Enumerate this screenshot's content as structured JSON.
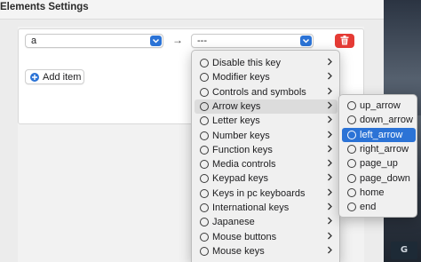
{
  "window": {
    "title": "Elements Settings"
  },
  "row": {
    "from_value": "a",
    "to_value": "---",
    "arrow_glyph": "→",
    "add_item_label": "Add item"
  },
  "category_menu": {
    "items": [
      {
        "label": "Disable this key",
        "has_submenu": true
      },
      {
        "label": "Modifier keys",
        "has_submenu": true
      },
      {
        "label": "Controls and symbols",
        "has_submenu": true
      },
      {
        "label": "Arrow keys",
        "has_submenu": true,
        "state": "hover"
      },
      {
        "label": "Letter keys",
        "has_submenu": true
      },
      {
        "label": "Number keys",
        "has_submenu": true
      },
      {
        "label": "Function keys",
        "has_submenu": true
      },
      {
        "label": "Media controls",
        "has_submenu": true
      },
      {
        "label": "Keypad keys",
        "has_submenu": true
      },
      {
        "label": "Keys in pc keyboards",
        "has_submenu": true
      },
      {
        "label": "International keys",
        "has_submenu": true
      },
      {
        "label": "Japanese",
        "has_submenu": true
      },
      {
        "label": "Mouse buttons",
        "has_submenu": true
      },
      {
        "label": "Mouse keys",
        "has_submenu": true
      }
    ]
  },
  "key_menu": {
    "items": [
      {
        "label": "up_arrow"
      },
      {
        "label": "down_arrow"
      },
      {
        "label": "left_arrow",
        "state": "selected"
      },
      {
        "label": "right_arrow"
      },
      {
        "label": "page_up"
      },
      {
        "label": "page_down"
      },
      {
        "label": "home"
      },
      {
        "label": "end"
      }
    ]
  },
  "icons": {
    "chevron": "chevron-up-down-icon",
    "delete": "trash-icon",
    "add": "plus-circle-icon",
    "submenu": "chevron-right-icon",
    "radio": "radio-circle-icon"
  },
  "colors": {
    "accent": "#2b73d6",
    "delete": "#e53b35",
    "menu_bg": "#f0f0f0",
    "hover_bg": "#dcdcdc"
  }
}
